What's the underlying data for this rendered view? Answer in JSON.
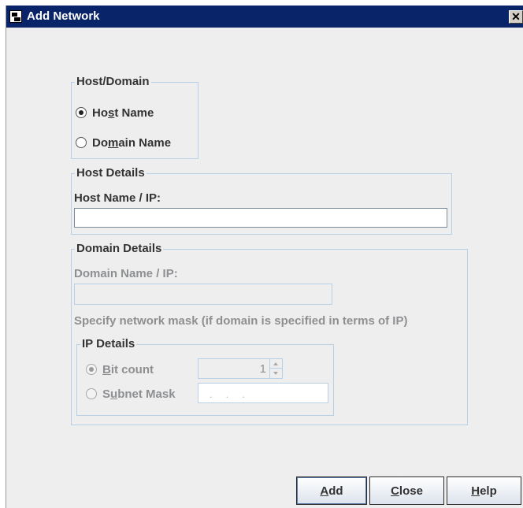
{
  "window": {
    "title": "Add Network",
    "close_glyph": "✕",
    "icons": {
      "app": "app-window-icon",
      "close": "close-icon"
    }
  },
  "host_domain": {
    "legend": "Host/Domain",
    "options": [
      {
        "label_pre": "Ho",
        "label_mnemonic": "s",
        "label_post": "t Name",
        "selected": true
      },
      {
        "label_pre": "Do",
        "label_mnemonic": "m",
        "label_post": "ain Name",
        "selected": false
      }
    ]
  },
  "host_details": {
    "legend": "Host Details",
    "field_label": "Host Name / IP:",
    "field_value": ""
  },
  "domain_details": {
    "legend": "Domain Details",
    "field_label": "Domain Name / IP:",
    "field_value": "",
    "mask_hint": "Specify network mask (if domain is specified in terms of IP)",
    "ip_details": {
      "legend": "IP Details",
      "bit_count": {
        "label_pre": "",
        "label_mnemonic": "B",
        "label_post": "it count",
        "selected": true,
        "value": "1"
      },
      "subnet_mask": {
        "label_pre": "S",
        "label_mnemonic": "u",
        "label_post": "bnet Mask",
        "selected": false,
        "value": ". . ."
      }
    }
  },
  "buttons": {
    "add": {
      "mnemonic": "A",
      "rest": "dd"
    },
    "close": {
      "mnemonic": "C",
      "rest": "lose"
    },
    "help": {
      "mnemonic": "H",
      "rest": "elp"
    }
  },
  "colors": {
    "titlebar": "#0a246a",
    "panel": "#eeeeee",
    "group_border": "#b8cfe5",
    "disabled_text": "#8e8f91"
  }
}
